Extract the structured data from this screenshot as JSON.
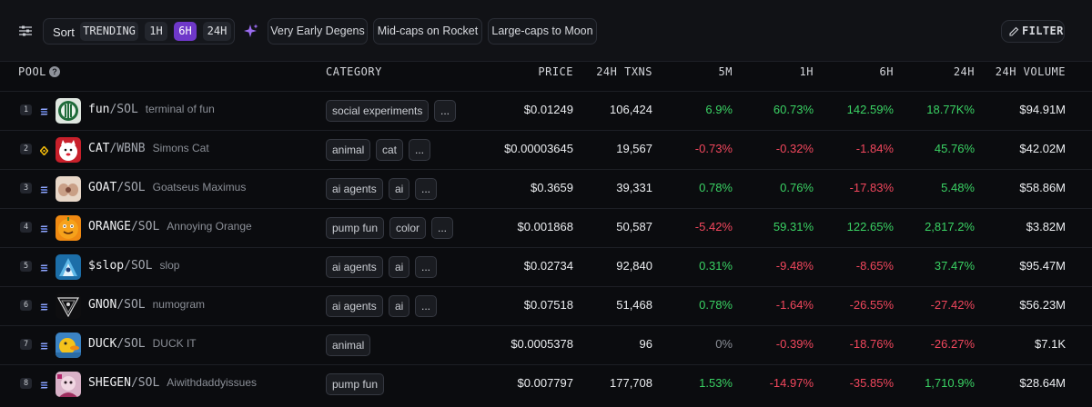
{
  "toolbar": {
    "sort_label": "Sort",
    "sort_options": [
      "TRENDING",
      "1H",
      "6H",
      "24H"
    ],
    "active_sort": "6H",
    "presets": [
      "Very Early Degens",
      "Mid-caps on Rocket",
      "Large-caps to Moon"
    ],
    "filter_label": "FILTER"
  },
  "table": {
    "headers": {
      "pool": "POOL",
      "category": "CATEGORY",
      "price": "PRICE",
      "txns": "24H TXNS",
      "m5": "5M",
      "h1": "1H",
      "h6": "6H",
      "h24": "24H",
      "volume": "24H VOLUME"
    },
    "rows": [
      {
        "rank": "1",
        "chain": "solana",
        "base": "fun",
        "quote": "/SOL",
        "name": "terminal of fun",
        "tags": [
          "social experiments",
          "..."
        ],
        "price": "$0.01249",
        "txns": "106,424",
        "m5": "6.9%",
        "h1": "60.73%",
        "h6": "142.59%",
        "h24": "18.77K%",
        "volume": "$94.91M"
      },
      {
        "rank": "2",
        "chain": "bnb",
        "base": "CAT",
        "quote": "/WBNB",
        "name": "Simons Cat",
        "tags": [
          "animal",
          "cat",
          "..."
        ],
        "price": "$0.00003645",
        "txns": "19,567",
        "m5": "-0.73%",
        "h1": "-0.32%",
        "h6": "-1.84%",
        "h24": "45.76%",
        "volume": "$42.02M"
      },
      {
        "rank": "3",
        "chain": "solana",
        "base": "GOAT",
        "quote": "/SOL",
        "name": "Goatseus Maximus",
        "tags": [
          "ai agents",
          "ai",
          "..."
        ],
        "price": "$0.3659",
        "txns": "39,331",
        "m5": "0.78%",
        "h1": "0.76%",
        "h6": "-17.83%",
        "h24": "5.48%",
        "volume": "$58.86M"
      },
      {
        "rank": "4",
        "chain": "solana",
        "base": "ORANGE",
        "quote": "/SOL",
        "name": "Annoying Orange",
        "tags": [
          "pump fun",
          "color",
          "..."
        ],
        "price": "$0.001868",
        "txns": "50,587",
        "m5": "-5.42%",
        "h1": "59.31%",
        "h6": "122.65%",
        "h24": "2,817.2%",
        "volume": "$3.82M"
      },
      {
        "rank": "5",
        "chain": "solana",
        "base": "$slop",
        "quote": "/SOL",
        "name": "slop",
        "tags": [
          "ai agents",
          "ai",
          "..."
        ],
        "price": "$0.02734",
        "txns": "92,840",
        "m5": "0.31%",
        "h1": "-9.48%",
        "h6": "-8.65%",
        "h24": "37.47%",
        "volume": "$95.47M"
      },
      {
        "rank": "6",
        "chain": "solana",
        "base": "GNON",
        "quote": "/SOL",
        "name": "numogram",
        "tags": [
          "ai agents",
          "ai",
          "..."
        ],
        "price": "$0.07518",
        "txns": "51,468",
        "m5": "0.78%",
        "h1": "-1.64%",
        "h6": "-26.55%",
        "h24": "-27.42%",
        "volume": "$56.23M"
      },
      {
        "rank": "7",
        "chain": "solana",
        "base": "DUCK",
        "quote": "/SOL",
        "name": "DUCK IT",
        "tags": [
          "animal"
        ],
        "price": "$0.0005378",
        "txns": "96",
        "m5": "0%",
        "h1": "-0.39%",
        "h6": "-18.76%",
        "h24": "-26.27%",
        "volume": "$7.1K"
      },
      {
        "rank": "8",
        "chain": "solana",
        "base": "SHEGEN",
        "quote": "/SOL",
        "name": "Aiwithdaddyissues",
        "tags": [
          "pump fun"
        ],
        "price": "$0.007797",
        "txns": "177,708",
        "m5": "1.53%",
        "h1": "-14.97%",
        "h6": "-35.85%",
        "h24": "1,710.9%",
        "volume": "$28.64M"
      }
    ]
  },
  "colors": {
    "up": "#3ad364",
    "down": "#f2475d",
    "accent": "#6f38c9"
  }
}
